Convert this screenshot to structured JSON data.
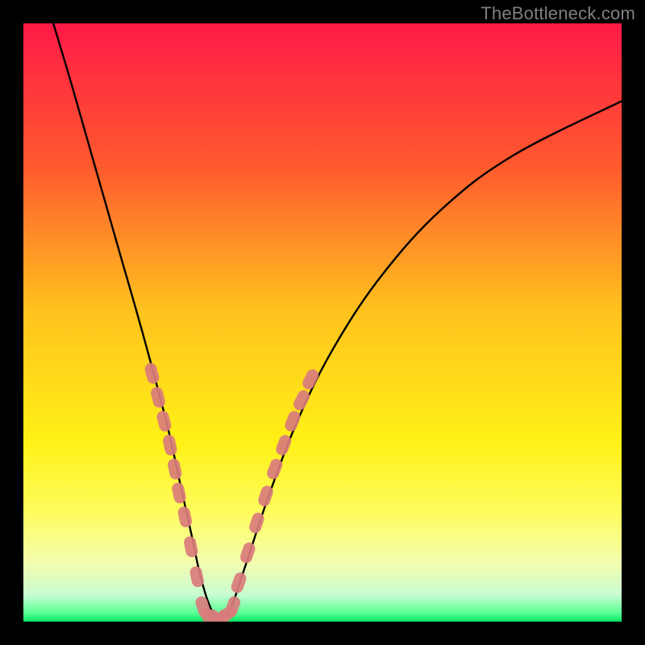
{
  "watermark": {
    "text": "TheBottleneck.com"
  },
  "chart_data": {
    "type": "line",
    "title": "",
    "xlabel": "",
    "ylabel": "",
    "xlim": [
      0,
      100
    ],
    "ylim": [
      0,
      100
    ],
    "background_gradient": {
      "direction": "vertical",
      "stops": [
        {
          "pos": 0.0,
          "color": "#ff1a47"
        },
        {
          "pos": 0.24,
          "color": "#ff5a2e"
        },
        {
          "pos": 0.48,
          "color": "#ffc21e"
        },
        {
          "pos": 0.7,
          "color": "#fff116"
        },
        {
          "pos": 0.82,
          "color": "#fdfd60"
        },
        {
          "pos": 0.9,
          "color": "#f4fdad"
        },
        {
          "pos": 0.955,
          "color": "#c9fcd1"
        },
        {
          "pos": 0.985,
          "color": "#5cff96"
        },
        {
          "pos": 1.0,
          "color": "#07e366"
        }
      ]
    },
    "series": [
      {
        "name": "bottleneck-curve",
        "x": [
          5,
          8,
          12,
          16,
          20,
          24,
          26,
          28,
          29.5,
          31,
          32.5,
          34.5,
          37,
          41,
          46,
          52,
          60,
          70,
          82,
          100
        ],
        "y": [
          100,
          90,
          76,
          62,
          48,
          33,
          24,
          15,
          8,
          3,
          0.5,
          2,
          9,
          21,
          34,
          46,
          58,
          69,
          78,
          87
        ]
      }
    ],
    "marker_clusters": [
      {
        "name": "left-limb-markers",
        "color": "#d97c7c",
        "points": [
          {
            "x": 21.5,
            "y": 41.5
          },
          {
            "x": 22.5,
            "y": 37.5
          },
          {
            "x": 23.5,
            "y": 33.5
          },
          {
            "x": 24.5,
            "y": 29.5
          },
          {
            "x": 25.3,
            "y": 25.5
          },
          {
            "x": 26.0,
            "y": 21.5
          },
          {
            "x": 27.0,
            "y": 17.5
          },
          {
            "x": 28.0,
            "y": 12.5
          },
          {
            "x": 29.0,
            "y": 7.5
          }
        ]
      },
      {
        "name": "valley-markers",
        "color": "#d97c7c",
        "points": [
          {
            "x": 30.0,
            "y": 2.5
          },
          {
            "x": 31.0,
            "y": 0.6
          },
          {
            "x": 32.0,
            "y": 0.4
          },
          {
            "x": 33.0,
            "y": 0.6
          },
          {
            "x": 34.0,
            "y": 1.2
          },
          {
            "x": 35.0,
            "y": 2.5
          }
        ]
      },
      {
        "name": "right-limb-markers",
        "color": "#d97c7c",
        "points": [
          {
            "x": 36.0,
            "y": 6.5
          },
          {
            "x": 37.5,
            "y": 11.5
          },
          {
            "x": 39.0,
            "y": 16.5
          },
          {
            "x": 40.5,
            "y": 21.0
          },
          {
            "x": 42.0,
            "y": 25.5
          },
          {
            "x": 43.5,
            "y": 29.5
          },
          {
            "x": 45.0,
            "y": 33.5
          },
          {
            "x": 46.5,
            "y": 37.0
          },
          {
            "x": 48.0,
            "y": 40.5
          }
        ]
      }
    ]
  }
}
